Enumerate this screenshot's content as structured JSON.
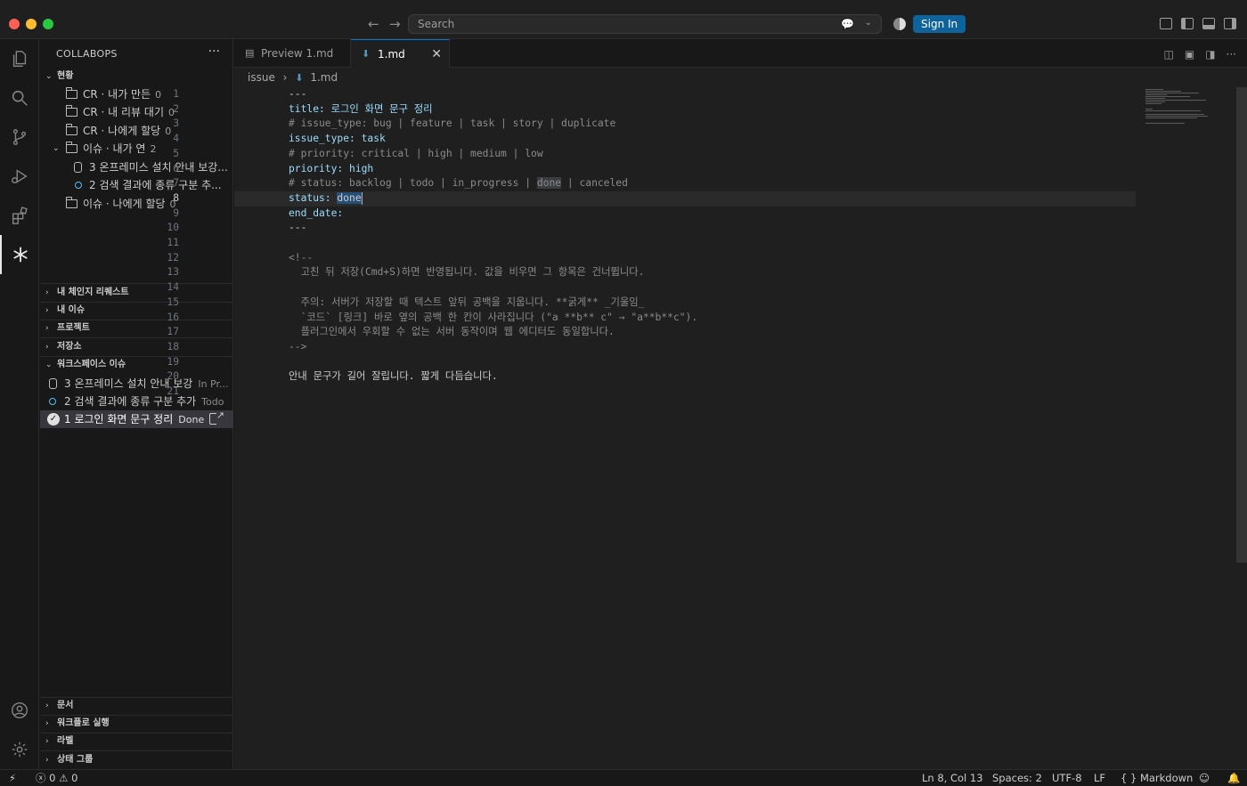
{
  "window": {
    "search_placeholder": "Search",
    "sign_in_label": "Sign In"
  },
  "sidebar": {
    "title": "COLLABOPS",
    "status_section": {
      "label": "현황",
      "items": [
        {
          "label": "CR · 내가 만든",
          "count": "0"
        },
        {
          "label": "CR · 내 리뷰 대기",
          "count": "0"
        },
        {
          "label": "CR · 나에게 할당",
          "count": "0"
        },
        {
          "label": "이슈 · 내가 연",
          "count": "2"
        },
        {
          "label": "3  온프레미스 설치 안내 보강..."
        },
        {
          "label": "2  검색 결과에 종류 구분 추..."
        },
        {
          "label": "이슈 · 나에게 할당",
          "count": "0"
        }
      ]
    },
    "sections": [
      {
        "label": "내 체인지 리퀘스트"
      },
      {
        "label": "내 이슈"
      },
      {
        "label": "프로젝트"
      },
      {
        "label": "저장소"
      }
    ],
    "workspace_issues": {
      "label": "워크스페이스 이슈",
      "items": [
        {
          "label": "3  온프레미스 설치 안내 보강",
          "status": "In Pr..."
        },
        {
          "label": "2  검색 결과에 종류 구분 추가",
          "status": "Todo"
        },
        {
          "label": "1  로그인 화면 문구 정리",
          "status": "Done"
        }
      ]
    },
    "bottom_sections": [
      {
        "label": "문서"
      },
      {
        "label": "워크플로 실행"
      },
      {
        "label": "라벨"
      },
      {
        "label": "상태 그룹"
      }
    ]
  },
  "tabs": [
    {
      "label": "Preview 1.md"
    },
    {
      "label": "1.md"
    }
  ],
  "breadcrumb": {
    "folder": "issue",
    "file": "1.md"
  },
  "editor": {
    "line_numbers": [
      "1",
      "2",
      "3",
      "4",
      "5",
      "6",
      "7",
      "8",
      "9",
      "10",
      "11",
      "12",
      "13",
      "14",
      "15",
      "16",
      "17",
      "18",
      "19",
      "20",
      "21"
    ],
    "lines": {
      "l1": "---",
      "l2_key": "title:",
      "l2_val": " 로그인 화면 문구 정리",
      "l3": "# issue_type: bug | feature | task | story | duplicate",
      "l4_key": "issue_type:",
      "l4_val": " task",
      "l5": "# priority: critical | high | medium | low",
      "l6_key": "priority:",
      "l6_val": " high",
      "l7_a": "# status: backlog | todo | in_progress | ",
      "l7_b": "done",
      "l7_c": " | canceled",
      "l8_key": "status:",
      "l8_val": "done",
      "l9_key": "end_date:",
      "l10": "---",
      "l12": "<!--",
      "l13": "  고친 뒤 저장(Cmd+S)하면 반영됩니다. 값을 비우면 그 항목은 건너뜁니다.",
      "l15": "  주의: 서버가 저장할 때 텍스트 앞뒤 공백을 지웁니다. **굵게** _기울임_",
      "l16": "  `코드` [링크] 바로 옆의 공백 한 칸이 사라집니다 (\"a **b** c\" → \"a**b**c\").",
      "l17": "  플러그인에서 우회할 수 없는 서버 동작이며 웹 에디터도 동일합니다.",
      "l18": "-->",
      "l20": "안내 문구가 길어 잘립니다. 짧게 다듬습니다."
    }
  },
  "status_bar": {
    "errors": "0",
    "warnings": "0",
    "cursor": "Ln 8, Col 13",
    "spaces": "Spaces: 2",
    "encoding": "UTF-8",
    "eol": "LF",
    "language": "{ } Markdown"
  }
}
